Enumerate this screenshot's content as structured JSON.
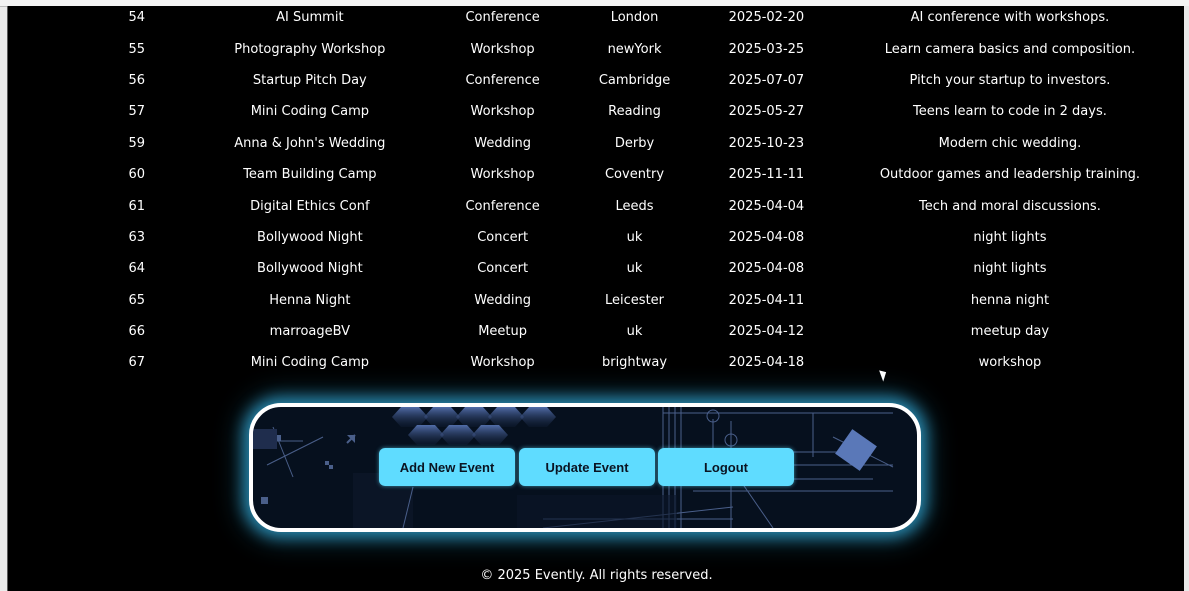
{
  "events": {
    "rows": [
      {
        "id": "54",
        "name": "AI Summit",
        "type": "Conference",
        "location": "London",
        "date": "2025-02-20",
        "description": "AI conference with workshops."
      },
      {
        "id": "55",
        "name": "Photography Workshop",
        "type": "Workshop",
        "location": "newYork",
        "date": "2025-03-25",
        "description": "Learn camera basics and composition."
      },
      {
        "id": "56",
        "name": "Startup Pitch Day",
        "type": "Conference",
        "location": "Cambridge",
        "date": "2025-07-07",
        "description": "Pitch your startup to investors."
      },
      {
        "id": "57",
        "name": "Mini Coding Camp",
        "type": "Workshop",
        "location": "Reading",
        "date": "2025-05-27",
        "description": "Teens learn to code in 2 days."
      },
      {
        "id": "59",
        "name": "Anna & John's Wedding",
        "type": "Wedding",
        "location": "Derby",
        "date": "2025-10-23",
        "description": "Modern chic wedding."
      },
      {
        "id": "60",
        "name": "Team Building Camp",
        "type": "Workshop",
        "location": "Coventry",
        "date": "2025-11-11",
        "description": "Outdoor games and leadership training."
      },
      {
        "id": "61",
        "name": "Digital Ethics Conf",
        "type": "Conference",
        "location": "Leeds",
        "date": "2025-04-04",
        "description": "Tech and moral discussions."
      },
      {
        "id": "63",
        "name": "Bollywood Night",
        "type": "Concert",
        "location": "uk",
        "date": "2025-04-08",
        "description": "night lights"
      },
      {
        "id": "64",
        "name": "Bollywood Night",
        "type": "Concert",
        "location": "uk",
        "date": "2025-04-08",
        "description": "night lights"
      },
      {
        "id": "65",
        "name": "Henna Night",
        "type": "Wedding",
        "location": "Leicester",
        "date": "2025-04-11",
        "description": "henna night"
      },
      {
        "id": "66",
        "name": "marroageBV",
        "type": "Meetup",
        "location": "uk",
        "date": "2025-04-12",
        "description": "meetup day"
      },
      {
        "id": "67",
        "name": "Mini Coding Camp",
        "type": "Workshop",
        "location": "brightway",
        "date": "2025-04-18",
        "description": "workshop"
      }
    ]
  },
  "actions": {
    "add_label": "Add New Event",
    "update_label": "Update Event",
    "logout_label": "Logout"
  },
  "footer": {
    "text": "© 2025 Evently. All rights reserved."
  },
  "colors": {
    "background": "#000000",
    "button_accent": "#5fdcff",
    "glow": "#3cc8ff",
    "text": "#ffffff"
  }
}
